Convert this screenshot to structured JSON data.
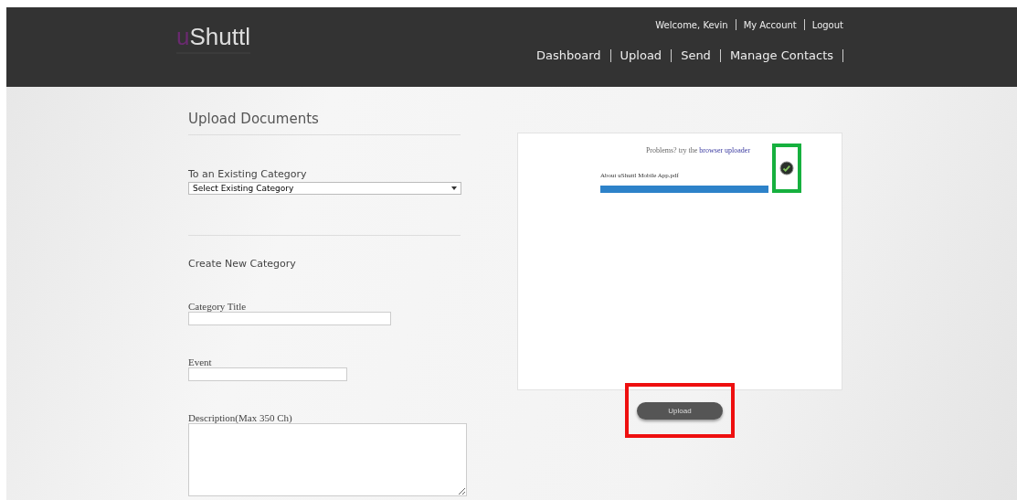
{
  "header": {
    "logo": {
      "accent": "u",
      "rest": "Shuttl"
    },
    "user_links": [
      "Welcome, Kevin",
      "My Account",
      "Logout"
    ],
    "nav": [
      "Dashboard",
      "Upload",
      "Send",
      "Manage Contacts"
    ]
  },
  "form": {
    "title": "Upload Documents",
    "existing_label": "To an Existing Category",
    "existing_select": "Select Existing Category",
    "new_heading": "Create New Category",
    "fields": [
      {
        "label": "Category Title",
        "kind": "long"
      },
      {
        "label": "Event",
        "kind": "short"
      },
      {
        "label": "Description(Max 350 Ch)",
        "kind": "area"
      }
    ]
  },
  "uploader": {
    "hint_text": "Problems? try the",
    "hint_link": "browser uploader",
    "file": {
      "name": "About uShuttl Mobile App.pdf",
      "level": 1,
      "done": true,
      "highlighted": true
    },
    "button": {
      "label": "Upload",
      "highlighted": true
    }
  }
}
